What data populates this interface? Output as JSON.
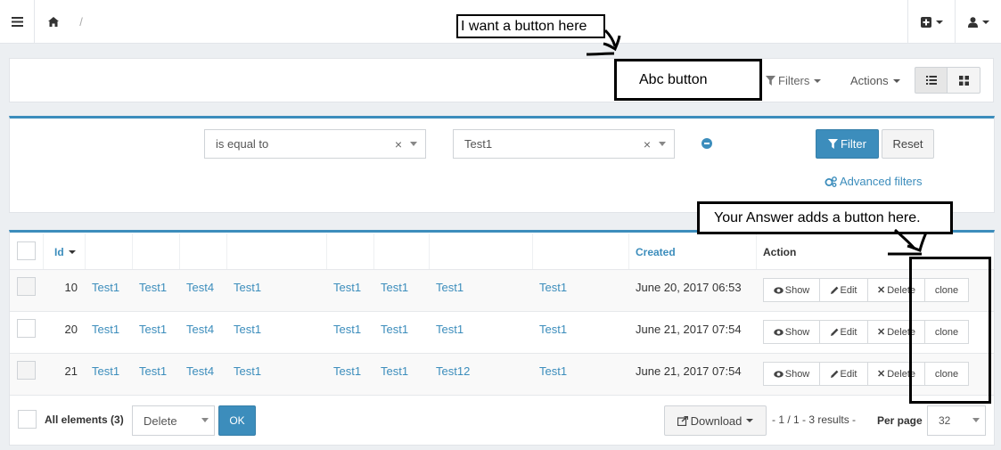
{
  "topbar": {
    "breadcrumb_sep": "/"
  },
  "toolbar": {
    "filters_label": "Filters",
    "actions_label": "Actions"
  },
  "annotations": {
    "want_button": "I want a button here",
    "abc_button": "Abc button",
    "answer_adds": "Your Answer adds a button here."
  },
  "filter": {
    "operator": "is equal to",
    "value": "Test1",
    "filter_button": "Filter",
    "reset_button": "Reset",
    "advanced_link": "Advanced filters"
  },
  "table": {
    "headers": {
      "id": "Id",
      "created": "Created",
      "action": "Action"
    },
    "rows": [
      {
        "id": "10",
        "c1": "Test1",
        "c2": "Test1",
        "c3": "Test4",
        "c4": "Test1",
        "c5": "Test1",
        "c6": "Test1",
        "c7": "Test1",
        "c8": "Test1",
        "created": "June 20, 2017 06:53"
      },
      {
        "id": "20",
        "c1": "Test1",
        "c2": "Test1",
        "c3": "Test4",
        "c4": "Test1",
        "c5": "Test1",
        "c6": "Test1",
        "c7": "Test1",
        "c8": "Test1",
        "created": "June 21, 2017 07:54"
      },
      {
        "id": "21",
        "c1": "Test1",
        "c2": "Test1",
        "c3": "Test4",
        "c4": "Test1",
        "c5": "Test1",
        "c6": "Test1",
        "c7": "Test12",
        "c8": "Test1",
        "created": "June 21, 2017 07:54"
      }
    ],
    "actions": {
      "show": "Show",
      "edit": "Edit",
      "delete": "Delete",
      "clone": "clone"
    }
  },
  "footer": {
    "all_elements": "All elements (3)",
    "batch_action": "Delete",
    "ok": "OK",
    "download": "Download",
    "pager": "- 1 / 1 - 3 results -",
    "per_page_label": "Per page",
    "per_page_value": "32"
  }
}
